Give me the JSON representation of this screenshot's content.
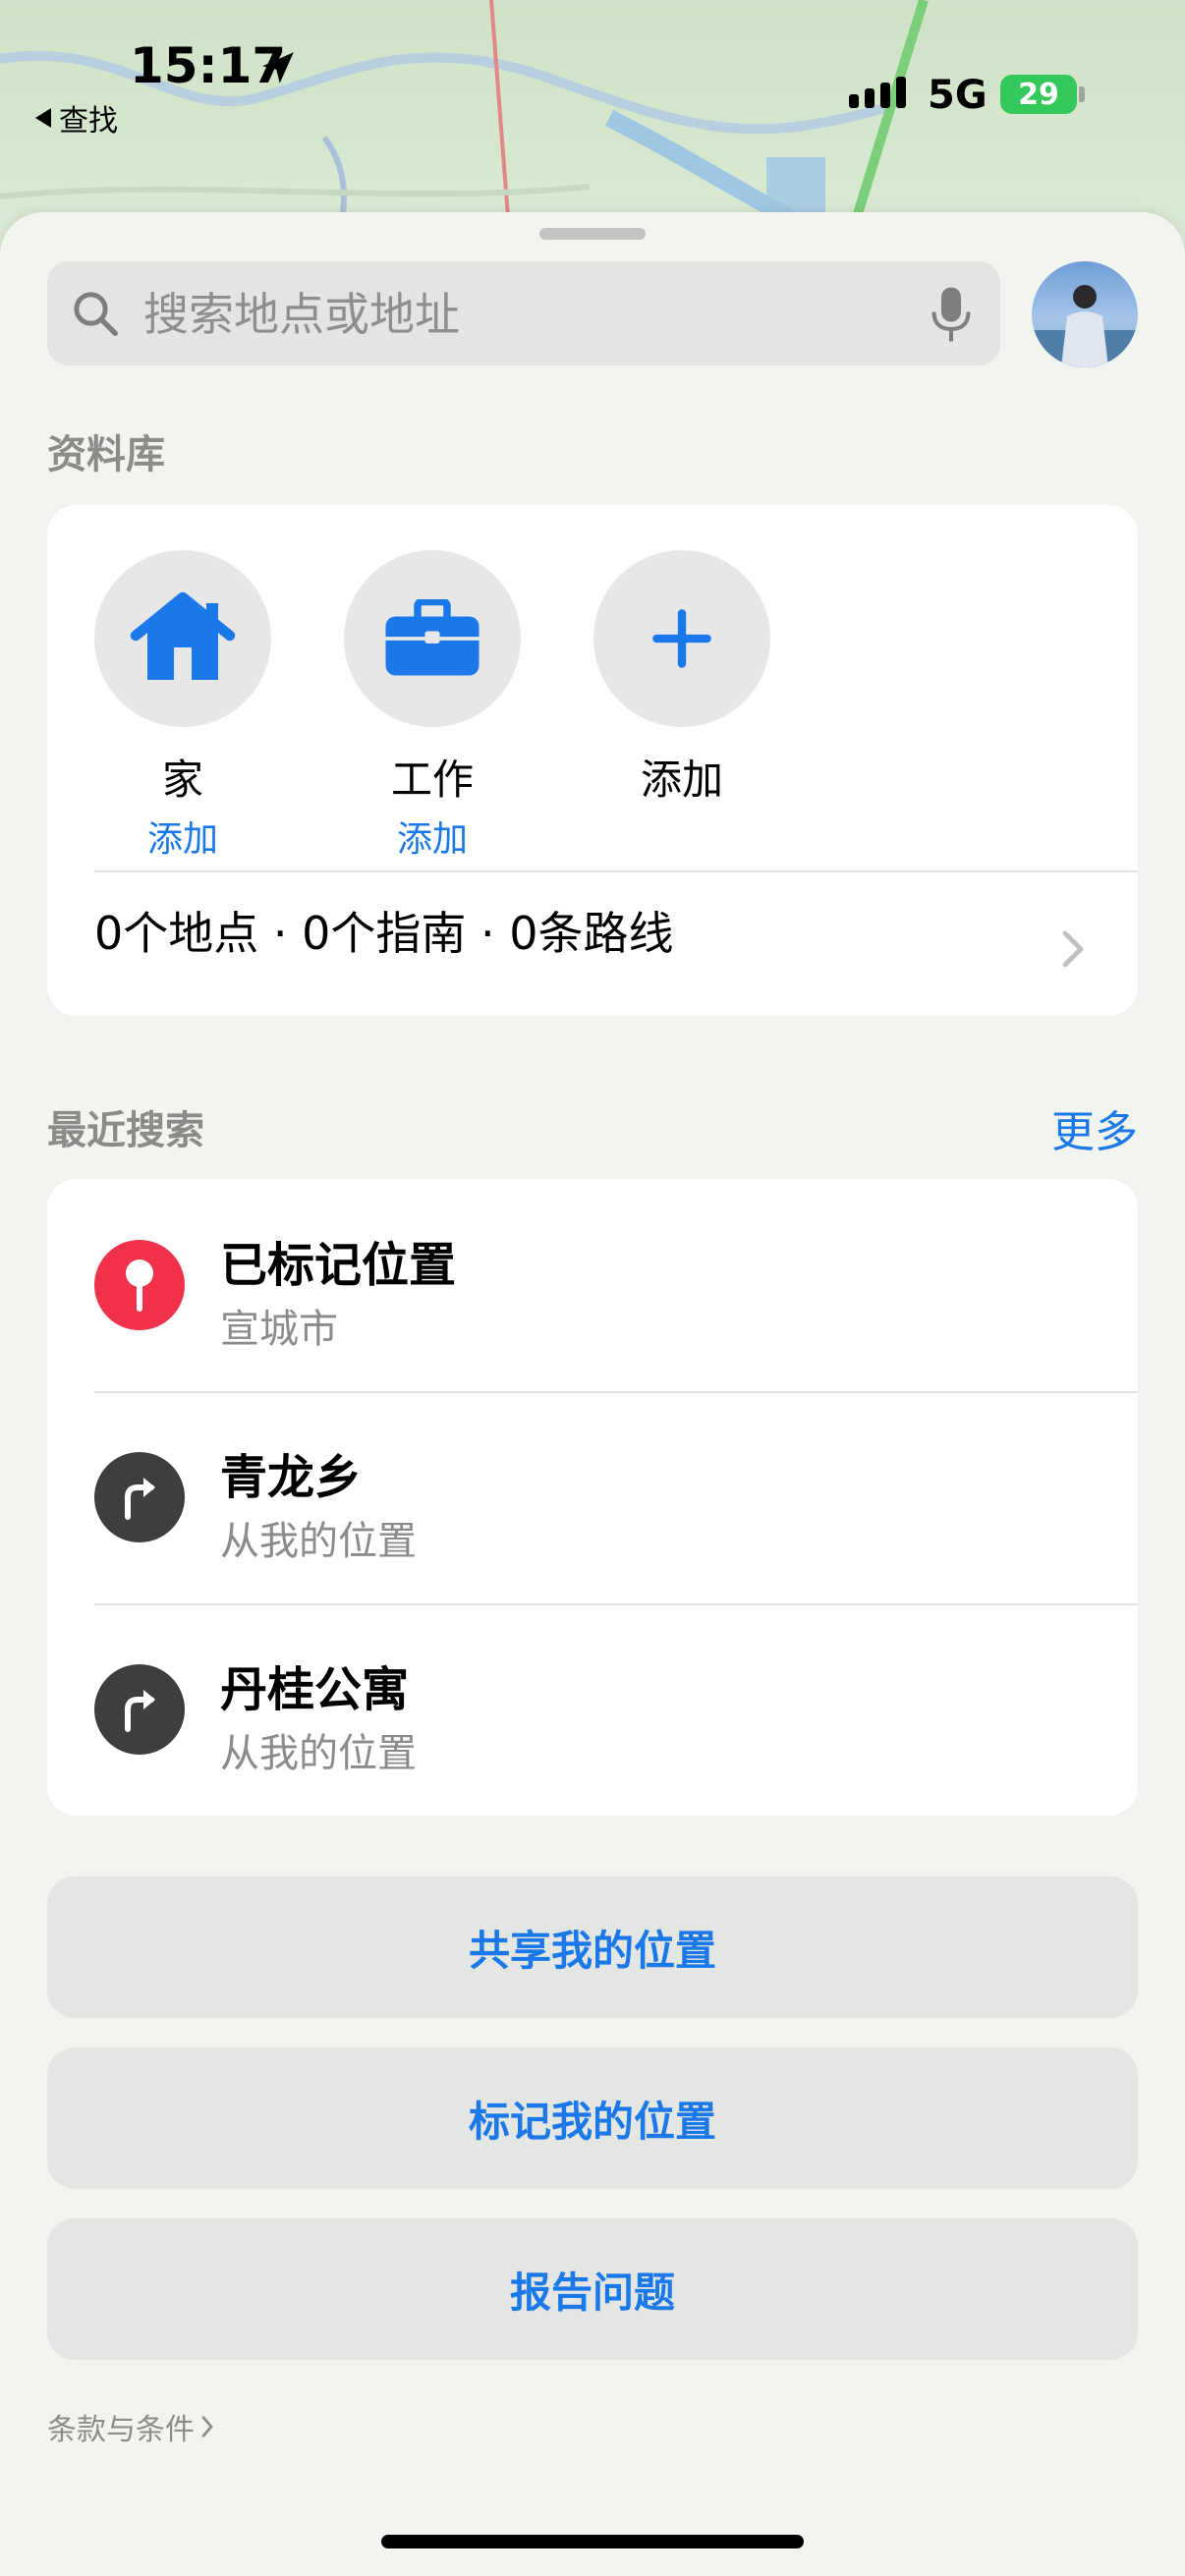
{
  "status_bar": {
    "time": "15:17",
    "back_label": "查找",
    "network": "5G",
    "battery": "29"
  },
  "search": {
    "placeholder": "搜索地点或地址"
  },
  "library": {
    "title": "资料库",
    "favorites": [
      {
        "label": "家",
        "sub": "添加",
        "icon": "house-icon"
      },
      {
        "label": "工作",
        "sub": "添加",
        "icon": "briefcase-icon"
      },
      {
        "label": "添加",
        "icon": "plus-icon"
      }
    ],
    "summary": "0个地点 · 0个指南 · 0条路线"
  },
  "recents": {
    "title": "最近搜索",
    "more_label": "更多",
    "items": [
      {
        "title": "已标记位置",
        "subtitle": "宣城市",
        "icon": "pin-icon",
        "color": "#f2324a"
      },
      {
        "title": "青龙乡",
        "subtitle": "从我的位置",
        "icon": "turn-right-icon",
        "color": "#3d3f3d"
      },
      {
        "title": "丹桂公寓",
        "subtitle": "从我的位置",
        "icon": "turn-right-icon",
        "color": "#3d3f3d"
      }
    ]
  },
  "actions": {
    "share": "共享我的位置",
    "mark": "标记我的位置",
    "report": "报告问题"
  },
  "footer": {
    "terms": "条款与条件"
  },
  "colors": {
    "accent": "#1a78e8",
    "battery": "#34c759"
  }
}
